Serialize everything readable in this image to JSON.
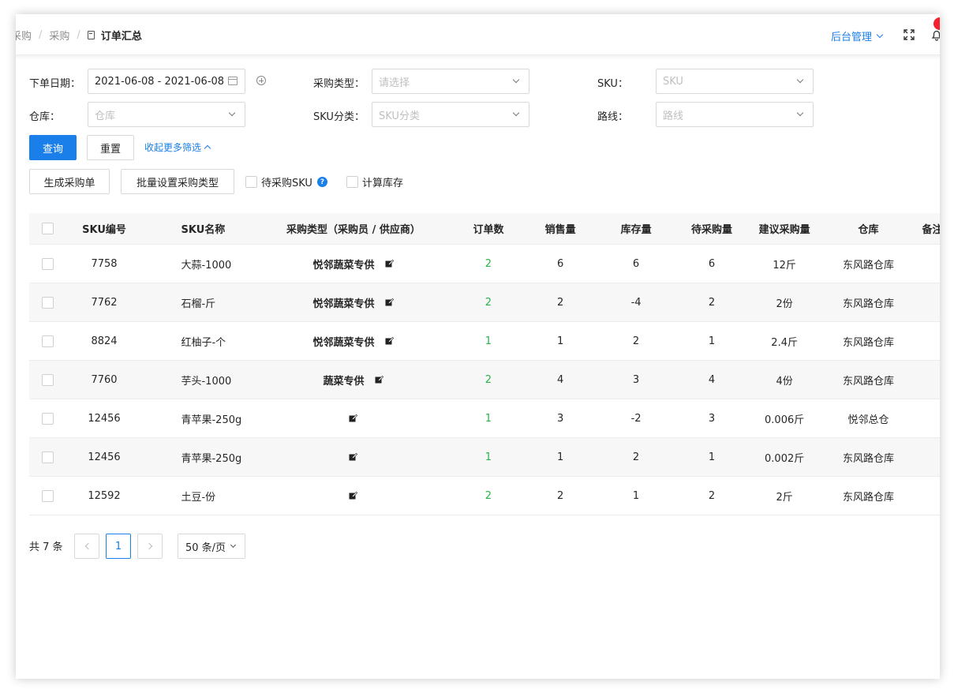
{
  "breadcrumb": [
    "采购",
    "采购"
  ],
  "page_title": "订单汇总",
  "header": {
    "admin_label": "后台管理"
  },
  "filters": {
    "order_date": {
      "label": "下单日期：",
      "value": "2021-06-08 - 2021-06-08"
    },
    "purchase_type": {
      "label": "采购类型：",
      "placeholder": "请选择"
    },
    "sku": {
      "label": "SKU：",
      "placeholder": "SKU"
    },
    "warehouse": {
      "label": "仓库：",
      "placeholder": "仓库"
    },
    "sku_category": {
      "label": "SKU分类：",
      "placeholder": "SKU分类"
    },
    "route": {
      "label": "路线：",
      "placeholder": "路线"
    }
  },
  "actions": {
    "query": "查询",
    "reset": "重置",
    "collapse": "收起更多筛选",
    "generate": "生成采购单",
    "batch_set": "批量设置采购类型",
    "pending_sku": "待采购SKU",
    "help": "?",
    "calc_stock": "计算库存"
  },
  "table": {
    "headers": {
      "code": "SKU编号",
      "name": "SKU名称",
      "type": "采购类型（采购员 / 供应商）",
      "orders": "订单数",
      "sales": "销售量",
      "stock": "库存量",
      "pending": "待采购量",
      "suggest": "建议采购量",
      "warehouse": "仓库",
      "note": "备注"
    },
    "rows": [
      {
        "code": "7758",
        "name": "大蒜-1000",
        "supplier": "悦邻蔬菜专供",
        "orders": "2",
        "sales": "6",
        "stock": "6",
        "pending": "6",
        "suggest": "12斤",
        "warehouse": "东风路仓库"
      },
      {
        "code": "7762",
        "name": "石榴-斤",
        "supplier": "悦邻蔬菜专供",
        "orders": "2",
        "sales": "2",
        "stock": "-4",
        "pending": "2",
        "suggest": "2份",
        "warehouse": "东风路仓库"
      },
      {
        "code": "8824",
        "name": "红柚子-个",
        "supplier": "悦邻蔬菜专供",
        "orders": "1",
        "sales": "1",
        "stock": "2",
        "pending": "1",
        "suggest": "2.4斤",
        "warehouse": "东风路仓库"
      },
      {
        "code": "7760",
        "name": "芋头-1000",
        "supplier": "蔬菜专供",
        "orders": "2",
        "sales": "4",
        "stock": "3",
        "pending": "4",
        "suggest": "4份",
        "warehouse": "东风路仓库"
      },
      {
        "code": "12456",
        "name": "青苹果-250g",
        "supplier": "",
        "orders": "1",
        "sales": "3",
        "stock": "-2",
        "pending": "3",
        "suggest": "0.006斤",
        "warehouse": "悦邻总仓"
      },
      {
        "code": "12456",
        "name": "青苹果-250g",
        "supplier": "",
        "orders": "1",
        "sales": "1",
        "stock": "2",
        "pending": "1",
        "suggest": "0.002斤",
        "warehouse": "东风路仓库"
      },
      {
        "code": "12592",
        "name": "土豆-份",
        "supplier": "",
        "orders": "2",
        "sales": "2",
        "stock": "1",
        "pending": "2",
        "suggest": "2斤",
        "warehouse": "东风路仓库"
      }
    ]
  },
  "pagination": {
    "total": "共 7 条",
    "current_page": "1",
    "page_size": "50 条/页"
  },
  "colors": {
    "primary": "#1a7fe8",
    "green": "#2bb24c",
    "badge": "#f5222d"
  },
  "icons": [
    "document-icon",
    "chevron-down-icon",
    "fullscreen-icon",
    "bell-icon",
    "calendar-icon",
    "plus-circle-icon",
    "chevron-up-icon",
    "help-icon",
    "edit-icon"
  ]
}
